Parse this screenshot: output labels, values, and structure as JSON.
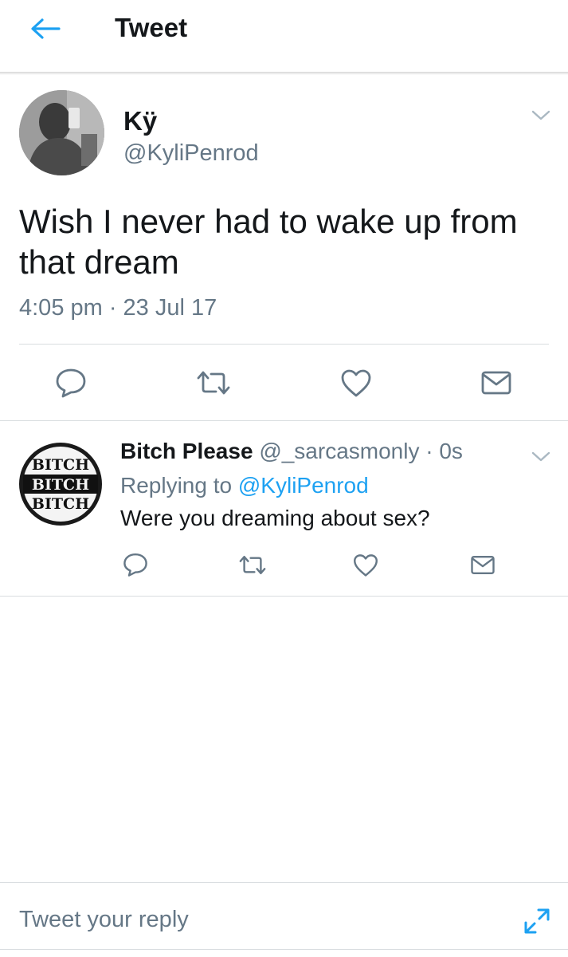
{
  "header": {
    "title": "Tweet"
  },
  "tweet": {
    "author_name": "Kÿ",
    "author_handle": "@KyliPenrod",
    "text": "Wish I never had to wake up from that dream",
    "timestamp": "4:05 pm · 23 Jul 17"
  },
  "reply": {
    "author_name": "Bitch Please",
    "meta": "@_sarcasmonly · 0s",
    "replying_prefix": "Replying to",
    "replying_mention": "@KyliPenrod",
    "text": "Were you dreaming about sex?",
    "avatar_lines": [
      "BITCH",
      "BITCH",
      "BITCH"
    ]
  },
  "reply_box": {
    "placeholder": "Tweet your reply"
  },
  "icons": {
    "back": "arrow-left-icon",
    "caret": "chevron-down-icon",
    "reply": "reply-icon",
    "retweet": "retweet-icon",
    "like": "heart-icon",
    "dm": "envelope-icon",
    "expand": "expand-icon"
  },
  "colors": {
    "accent": "#1da1f2",
    "text": "#14171a",
    "secondary": "#657786",
    "divider": "#d9dde0"
  }
}
